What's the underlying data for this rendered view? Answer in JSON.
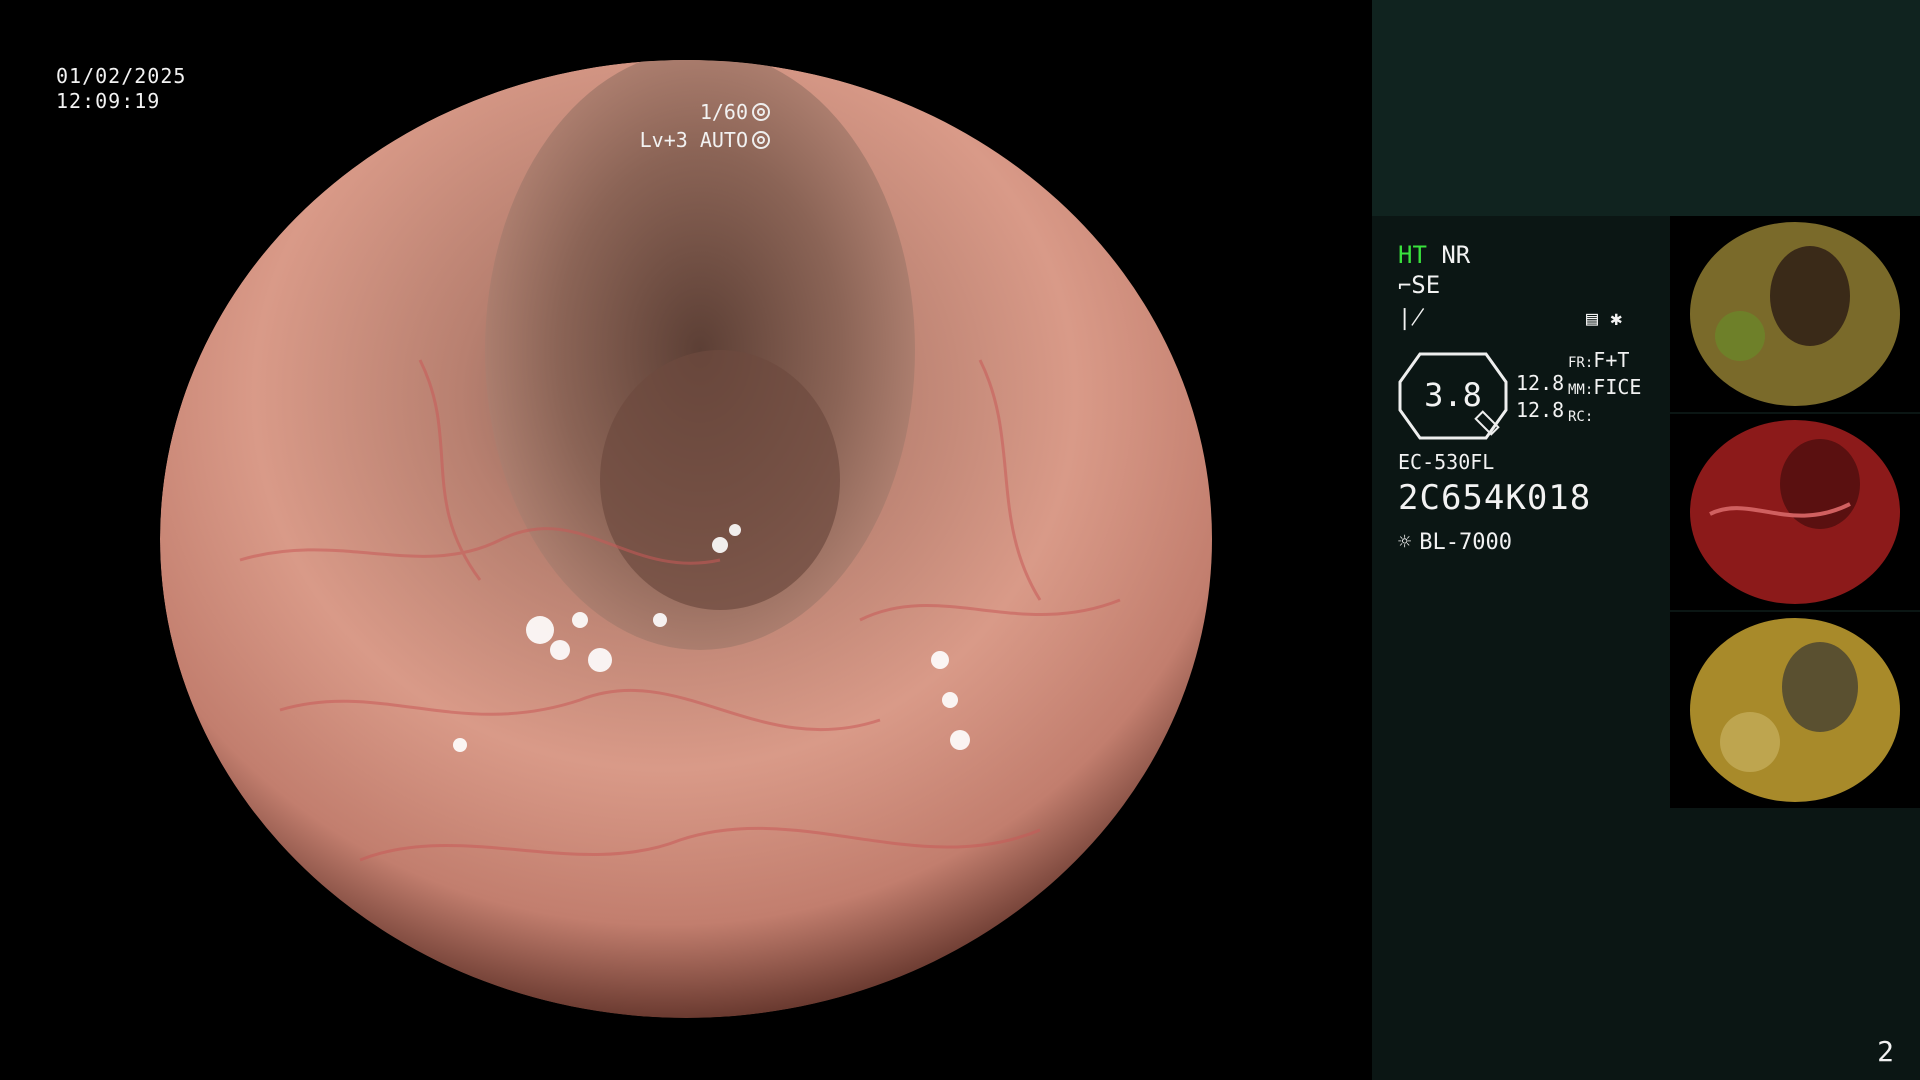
{
  "overlay": {
    "date": "01/02/2025",
    "time": "12:09:19",
    "shutter": "1/60",
    "iris": "Lv+3 AUTO"
  },
  "panel": {
    "mode_ht": "HT",
    "mode_nr": "NR",
    "enhance": "SE",
    "zoom_value": "3.8",
    "value_1": "12.8",
    "value_2": "12.8",
    "fr_label": "FR:",
    "fr_value": "F+T",
    "mm_label": "MM:",
    "mm_value": "FICE",
    "rc_label": "RC:",
    "scope_model": "EC-530FL",
    "serial": "2C654K018",
    "light_source": "BL-7000",
    "page_number": "2"
  },
  "icons": [
    "sun-icon",
    "asterisk-icon",
    "settings-icon",
    "iris-icon",
    "shutter-icon",
    "enhance-icon",
    "structure-icon"
  ],
  "thumbnails": [
    {
      "name": "thumbnail-1",
      "tone": "#7a6a2a"
    },
    {
      "name": "thumbnail-2",
      "tone": "#8c1a1a"
    },
    {
      "name": "thumbnail-3",
      "tone": "#a88a2a"
    }
  ]
}
